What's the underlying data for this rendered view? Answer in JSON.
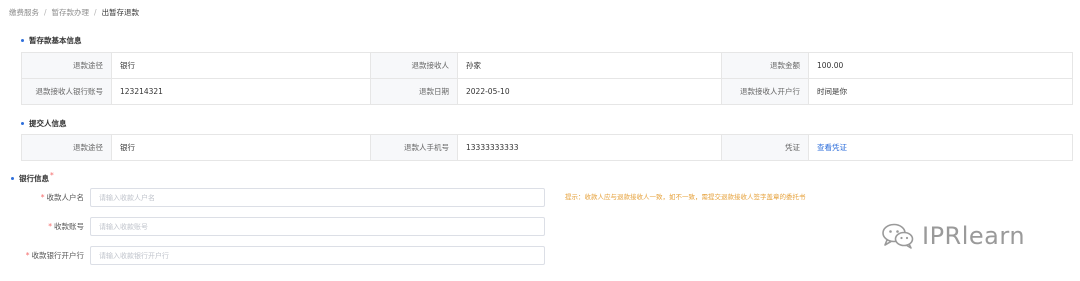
{
  "breadcrumb": [
    "缴费服务",
    "暂存款办理",
    "出暂存退款"
  ],
  "basic_info": {
    "title": "暂存款基本信息",
    "rows": [
      [
        {
          "label": "退款途径",
          "value": "银行"
        },
        {
          "label": "退款接收人",
          "value": "孙家"
        },
        {
          "label": "退款金额",
          "value": "100.00"
        }
      ],
      [
        {
          "label": "退款接收人银行账号",
          "value": "123214321"
        },
        {
          "label": "退款日期",
          "value": "2022-05-10"
        },
        {
          "label": "退款接收人开户行",
          "value": "时间是你"
        }
      ]
    ]
  },
  "submitter_info": {
    "title": "提交人信息",
    "row": [
      {
        "label": "退款途径",
        "value": "银行"
      },
      {
        "label": "退款人手机号",
        "value": "13333333333"
      },
      {
        "label": "凭证",
        "value": "查看凭证"
      }
    ]
  },
  "bank_info": {
    "title": "银行信息",
    "required_mark": "*",
    "fields": [
      {
        "label": "收款人户名",
        "placeholder": "请输入收款人户名"
      },
      {
        "label": "收款账号",
        "placeholder": "请输入收款账号"
      },
      {
        "label": "收款银行开户行",
        "placeholder": "请输入收款银行开户行"
      }
    ],
    "hint": "提示：收款人应与退款接收人一致，如不一致，需提交退款接收人签字盖章的委托书"
  },
  "watermark": {
    "text": "IPRlearn",
    "icon": "wechat-icon"
  },
  "colors": {
    "accent": "#2f6fdb",
    "required": "#f56c6c",
    "hint": "#e6a23c",
    "label_bg": "#f7f8fa",
    "border": "#e6e6e6"
  }
}
